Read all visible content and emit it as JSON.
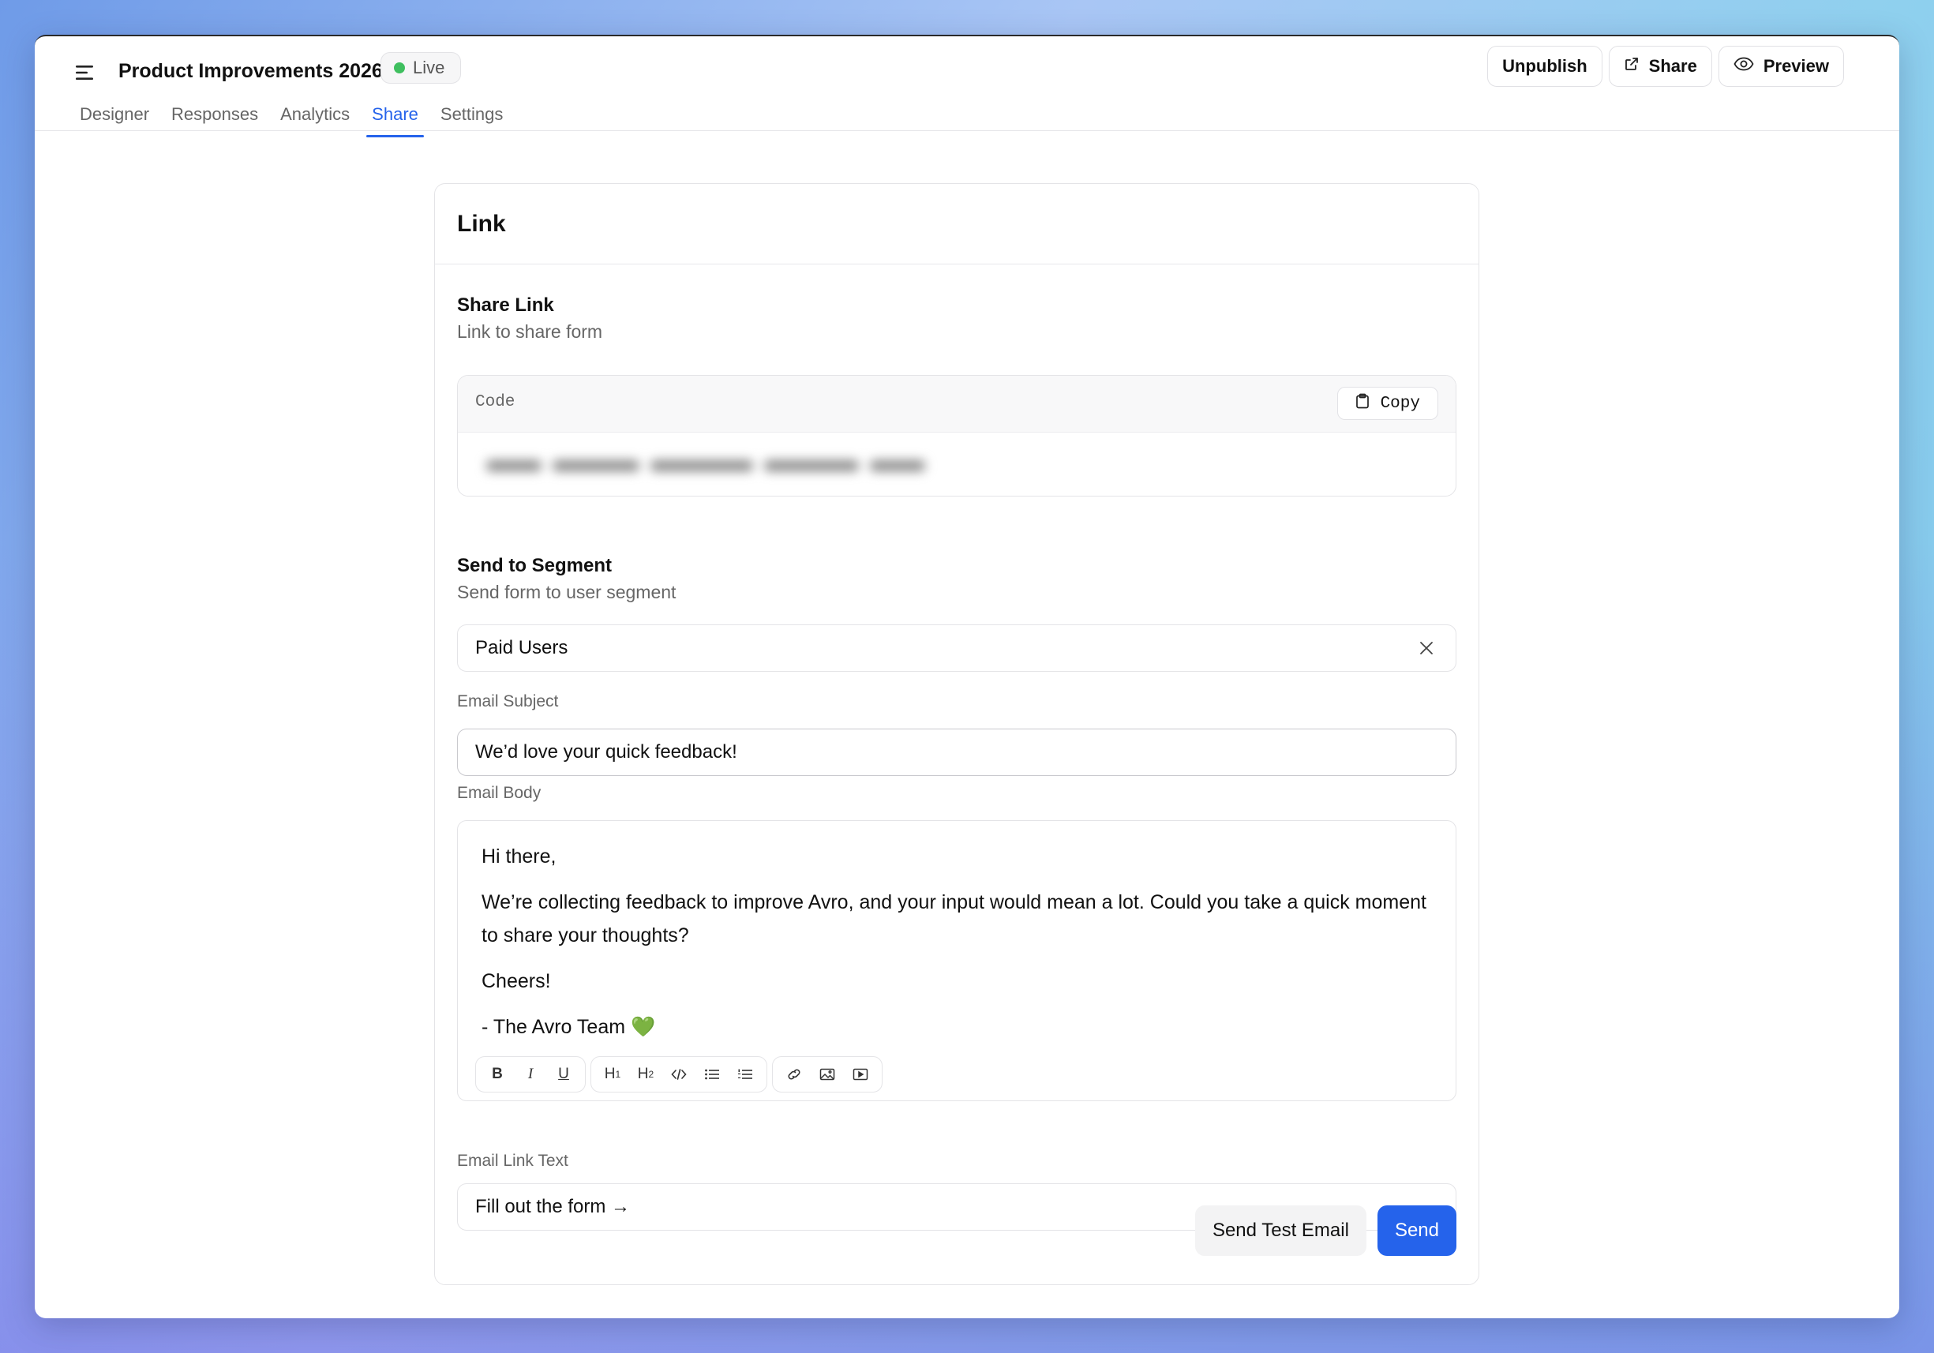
{
  "app": {
    "title": "Product Improvements 2026",
    "status": "Live",
    "status_color": "#3fbf5f"
  },
  "header_actions": {
    "unpublish_label": "Unpublish",
    "share_label": "Share",
    "preview_label": "Preview"
  },
  "tabs": [
    {
      "label": "Designer",
      "active": false
    },
    {
      "label": "Responses",
      "active": false
    },
    {
      "label": "Analytics",
      "active": false
    },
    {
      "label": "Share",
      "active": true
    },
    {
      "label": "Settings",
      "active": false
    }
  ],
  "accent_color": "#2563eb",
  "card": {
    "title": "Link",
    "share_link": {
      "title": "Share Link",
      "subtitle": "Link to share form",
      "code_label": "Code",
      "copy_label": "Copy"
    },
    "segment": {
      "title": "Send to Segment",
      "subtitle": "Send form to user segment",
      "selected": "Paid Users"
    },
    "email_subject": {
      "label": "Email Subject",
      "value": "We’d love your quick feedback!"
    },
    "email_body": {
      "label": "Email Body",
      "greeting": "Hi there,",
      "paragraph": "We’re collecting feedback to improve Avro, and your input would mean a lot. Could you take a quick moment to share your thoughts?",
      "signoff": "Cheers!",
      "signature": "- The Avro Team 💚"
    },
    "email_link_text": {
      "label": "Email Link Text",
      "value": "Fill out the form →"
    },
    "send_test_label": "Send Test Email",
    "send_label": "Send"
  },
  "toolbar_icons": [
    "bold-icon",
    "italic-icon",
    "underline-icon",
    "heading1-icon",
    "heading2-icon",
    "code-icon",
    "bullet-list-icon",
    "ordered-list-icon",
    "link-icon",
    "image-icon",
    "video-icon"
  ]
}
